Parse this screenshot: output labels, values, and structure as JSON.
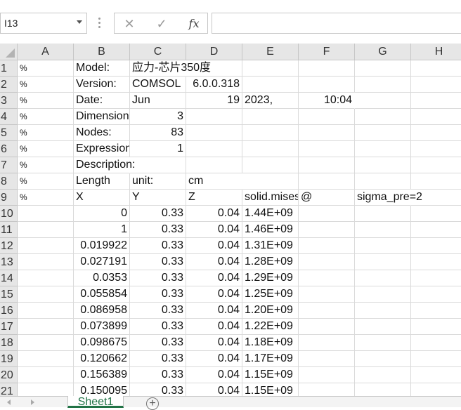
{
  "name_box": {
    "value": "I13"
  },
  "toolbar": {
    "cancel_glyph": "✕",
    "enter_glyph": "✓",
    "function_label": "fx"
  },
  "formula": {
    "value": ""
  },
  "columns": [
    "A",
    "B",
    "C",
    "D",
    "E",
    "F",
    "G",
    "H"
  ],
  "rows": [
    {
      "n": "1",
      "cells": {
        "A": "%",
        "B": "Model:",
        "C": "应力-芯片350度"
      }
    },
    {
      "n": "2",
      "cells": {
        "A": "%",
        "B": "Version:",
        "C": "COMSOL",
        "D": "6.0.0.318"
      }
    },
    {
      "n": "3",
      "cells": {
        "A": "%",
        "B": "Date:",
        "C": "Jun",
        "D": "19",
        "E": "2023,",
        "F": "10:04"
      }
    },
    {
      "n": "4",
      "cells": {
        "A": "%",
        "B": "Dimension",
        "C": "3"
      }
    },
    {
      "n": "5",
      "cells": {
        "A": "%",
        "B": "Nodes:",
        "C": "83"
      }
    },
    {
      "n": "6",
      "cells": {
        "A": "%",
        "B": "Expression",
        "C": "1"
      }
    },
    {
      "n": "7",
      "cells": {
        "A": "%",
        "B": "Description:"
      }
    },
    {
      "n": "8",
      "cells": {
        "A": "%",
        "B": "Length",
        "C": "unit:",
        "D": "cm"
      }
    },
    {
      "n": "9",
      "cells": {
        "A": "%",
        "B": "X",
        "C": "Y",
        "D": "Z",
        "E": "solid.mises",
        "F": "@",
        "G": "sigma_pre=2"
      }
    },
    {
      "n": "10",
      "cells": {
        "B": "0",
        "C": "0.33",
        "D": "0.04",
        "E": "1.44E+09"
      }
    },
    {
      "n": "11",
      "cells": {
        "B": "1",
        "C": "0.33",
        "D": "0.04",
        "E": "1.46E+09"
      }
    },
    {
      "n": "12",
      "cells": {
        "B": "0.019922",
        "C": "0.33",
        "D": "0.04",
        "E": "1.31E+09"
      }
    },
    {
      "n": "13",
      "cells": {
        "B": "0.027191",
        "C": "0.33",
        "D": "0.04",
        "E": "1.28E+09"
      }
    },
    {
      "n": "14",
      "cells": {
        "B": "0.0353",
        "C": "0.33",
        "D": "0.04",
        "E": "1.29E+09"
      }
    },
    {
      "n": "15",
      "cells": {
        "B": "0.055854",
        "C": "0.33",
        "D": "0.04",
        "E": "1.25E+09"
      }
    },
    {
      "n": "16",
      "cells": {
        "B": "0.086958",
        "C": "0.33",
        "D": "0.04",
        "E": "1.20E+09"
      }
    },
    {
      "n": "17",
      "cells": {
        "B": "0.073899",
        "C": "0.33",
        "D": "0.04",
        "E": "1.22E+09"
      }
    },
    {
      "n": "18",
      "cells": {
        "B": "0.098675",
        "C": "0.33",
        "D": "0.04",
        "E": "1.18E+09"
      }
    },
    {
      "n": "19",
      "cells": {
        "B": "0.120662",
        "C": "0.33",
        "D": "0.04",
        "E": "1.17E+09"
      }
    },
    {
      "n": "20",
      "cells": {
        "B": "0.156389",
        "C": "0.33",
        "D": "0.04",
        "E": "1.15E+09"
      }
    },
    {
      "n": "21",
      "cells": {
        "B": "0.150095",
        "C": "0.33",
        "D": "0.04",
        "E": "1.15E+09"
      }
    }
  ],
  "sheets": [
    {
      "label": "Sheet1",
      "active": true
    }
  ],
  "add_sheet_glyph": "+",
  "colors": {
    "accent": "#217346",
    "header_bg": "#e6e6e6",
    "gridline": "#dadada"
  }
}
